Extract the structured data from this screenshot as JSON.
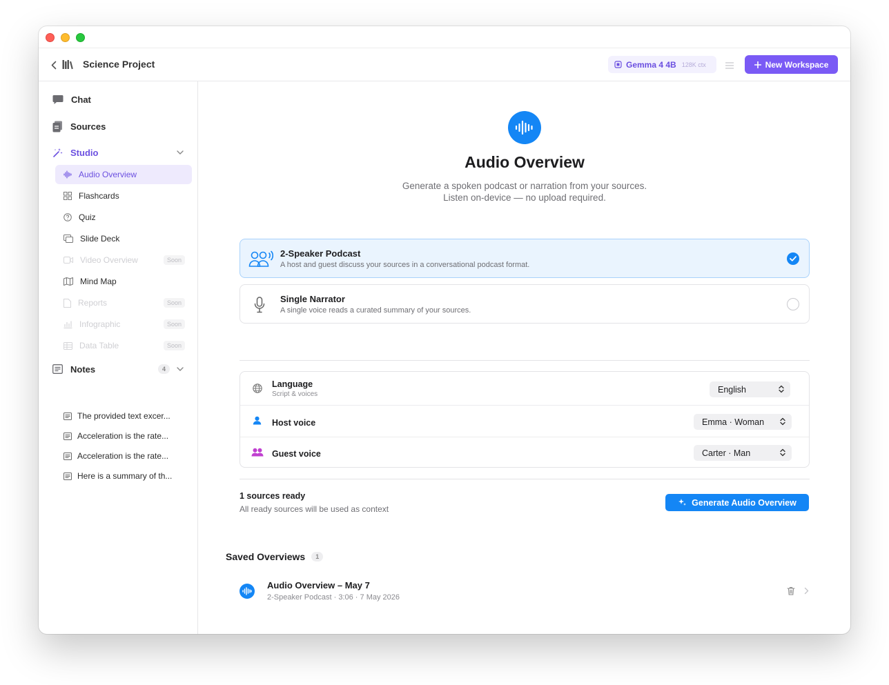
{
  "toolbar": {
    "project_title": "Science Project",
    "model_name": "Gemma 4 4B",
    "model_ctx": "128K ctx",
    "new_workspace_label": "New Workspace"
  },
  "sidebar": {
    "chat": "Chat",
    "sources": "Sources",
    "studio": "Studio",
    "studio_items": [
      {
        "label": "Audio Overview",
        "icon": "waveform-icon",
        "state": "active"
      },
      {
        "label": "Flashcards",
        "icon": "grid-icon",
        "state": "normal"
      },
      {
        "label": "Quiz",
        "icon": "question-circle-icon",
        "state": "normal"
      },
      {
        "label": "Slide Deck",
        "icon": "slides-icon",
        "state": "normal"
      },
      {
        "label": "Video Overview",
        "icon": "video-icon",
        "state": "disabled",
        "badge": "Soon"
      },
      {
        "label": "Mind Map",
        "icon": "map-icon",
        "state": "normal"
      },
      {
        "label": "Reports",
        "icon": "document-icon",
        "state": "disabled",
        "badge": "Soon"
      },
      {
        "label": "Infographic",
        "icon": "chart-icon",
        "state": "disabled",
        "badge": "Soon"
      },
      {
        "label": "Data Table",
        "icon": "table-icon",
        "state": "disabled",
        "badge": "Soon"
      }
    ],
    "notes_label": "Notes",
    "notes_count": "4",
    "notes": [
      "The provided text excer...",
      "Acceleration is the rate...",
      "Acceleration is the rate...",
      "Here is a summary of th..."
    ]
  },
  "main": {
    "title": "Audio Overview",
    "subtitle_line1": "Generate a spoken podcast or narration from your sources.",
    "subtitle_line2": "Listen on-device — no upload required.",
    "options": [
      {
        "title": "2-Speaker Podcast",
        "desc": "A host and guest discuss your sources in a conversational podcast format.",
        "selected": true
      },
      {
        "title": "Single Narrator",
        "desc": "A single voice reads a curated summary of your sources.",
        "selected": false
      }
    ],
    "settings": {
      "language_label": "Language",
      "language_sub": "Script & voices",
      "language_value": "English",
      "host_label": "Host voice",
      "host_value": "Emma · Woman",
      "guest_label": "Guest voice",
      "guest_value": "Carter · Man"
    },
    "ready_title": "1 sources ready",
    "ready_sub": "All ready sources will be used as context",
    "generate_label": "Generate Audio Overview",
    "saved_title": "Saved Overviews",
    "saved_count": "1",
    "saved": [
      {
        "name": "Audio Overview – May 7",
        "meta": "2-Speaker Podcast · 3:06 · 7 May 2026"
      }
    ]
  },
  "colors": {
    "accent_purple": "#7a5af5",
    "accent_blue": "#1486f5",
    "selected_bg": "#eaf4fe"
  }
}
